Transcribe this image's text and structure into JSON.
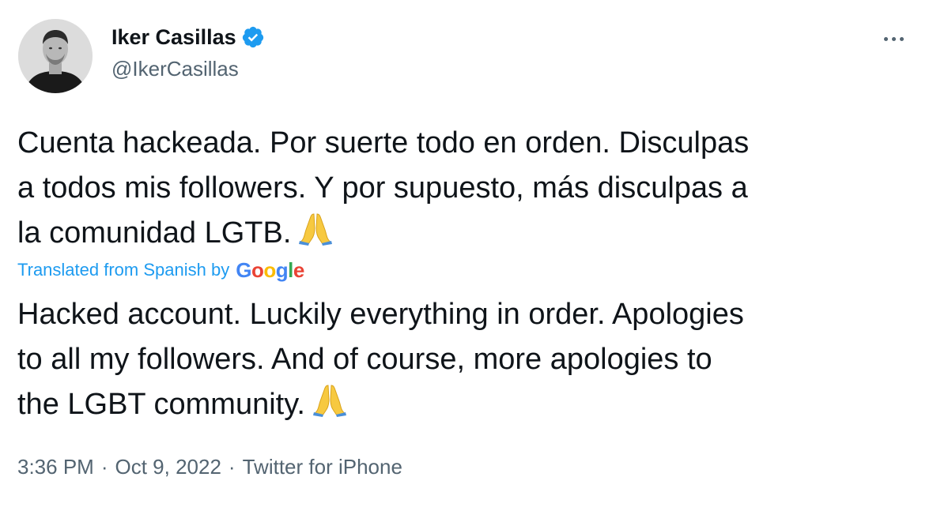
{
  "tweet": {
    "author": {
      "display_name": "Iker Casillas",
      "handle": "@IkerCasillas",
      "verified": true,
      "verified_icon": "verified-badge-icon",
      "verified_color": "#1d9bf0"
    },
    "more_icon": "more-horizontal-icon",
    "original_lines": [
      "Cuenta hackeada. Por suerte todo en orden. Disculpas",
      "a todos mis followers. Y por supuesto, más disculpas a",
      "la comunidad LGTB."
    ],
    "translation": {
      "label": "Translated from Spanish by",
      "logo_text": "Google",
      "label_color": "#1d9bf0"
    },
    "translated_lines": [
      "Hacked account. Luckily everything in order. Apologies",
      "to all my followers. And of course, more apologies to",
      "the LGBT community."
    ],
    "emoji": "folded-hands-icon",
    "meta": {
      "time": "3:36 PM",
      "date": "Oct 9, 2022",
      "source": "Twitter for iPhone",
      "separator": "·"
    }
  },
  "colors": {
    "text_primary": "#0f1419",
    "text_secondary": "#536471",
    "accent": "#1d9bf0"
  }
}
